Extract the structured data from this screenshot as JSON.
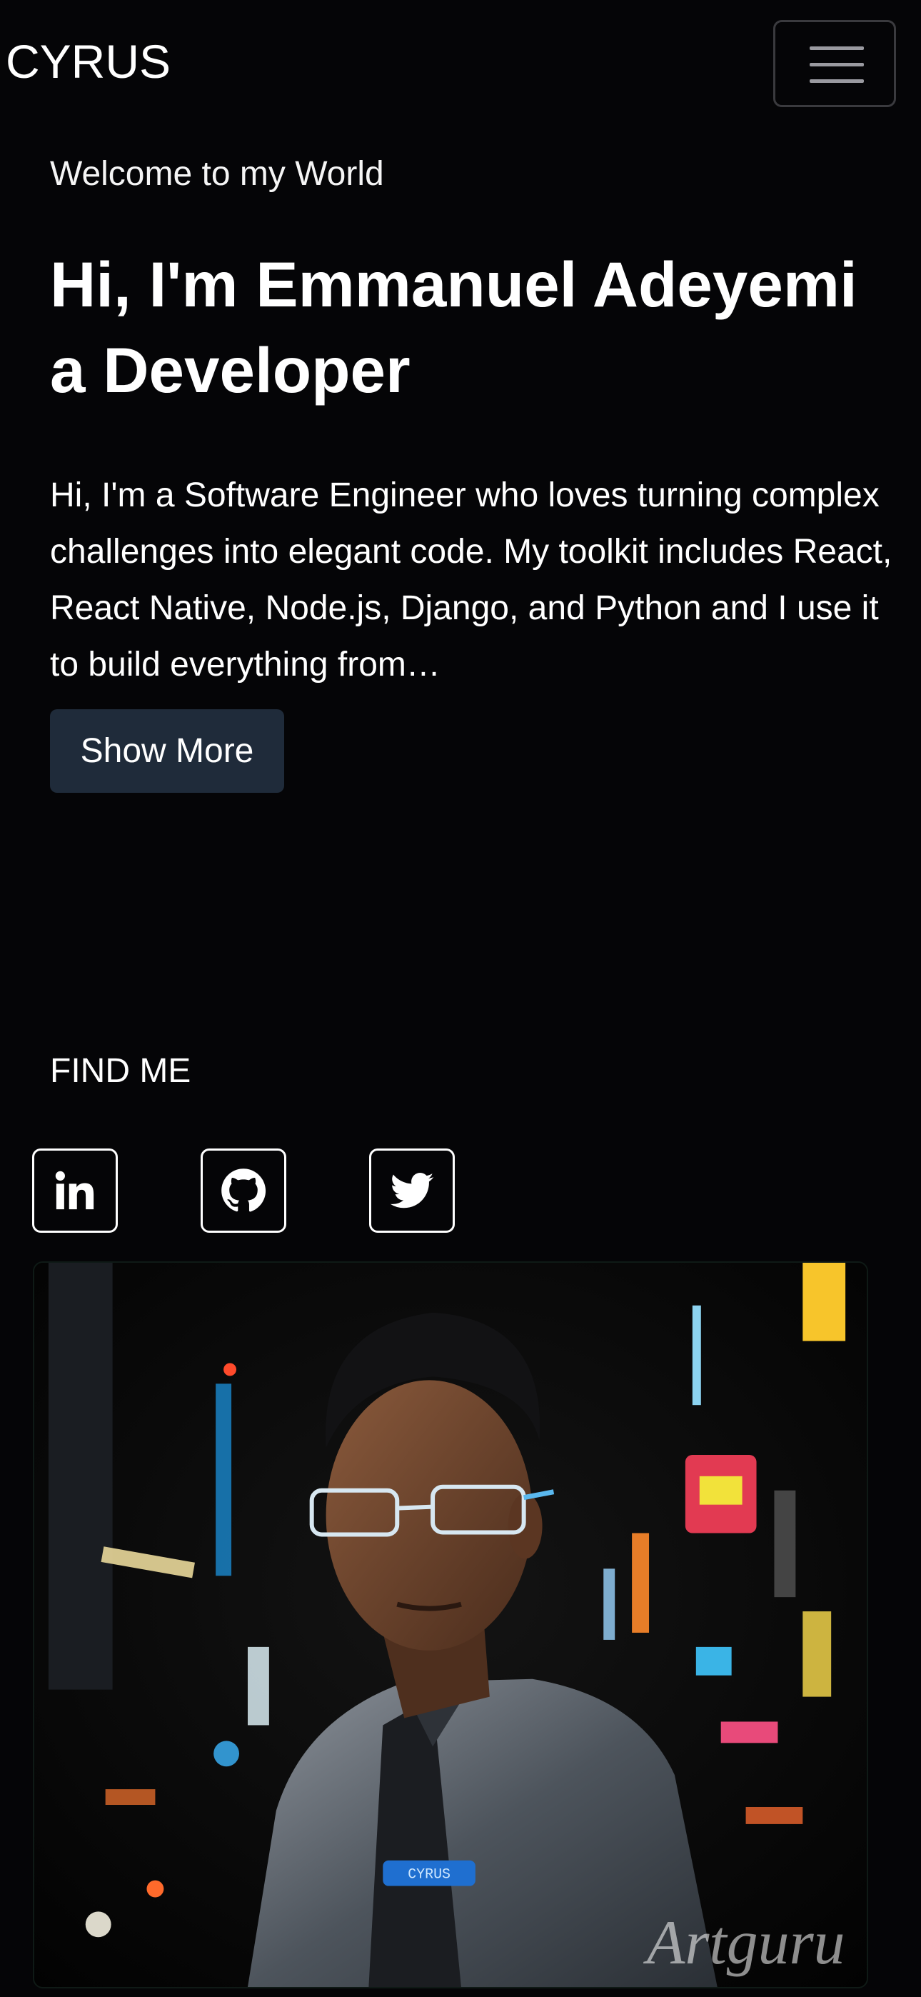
{
  "header": {
    "brand": "CYRUS",
    "menu_icon": "hamburger-icon"
  },
  "hero": {
    "welcome": "Welcome to my World",
    "title": "Hi, I'm Emmanuel Adeyemi a Developer",
    "bio": "Hi, I'm a Software Engineer who loves turning complex challenges into elegant code. My toolkit includes React, React Native, Node.js, Django, and Python and I use it to build everything from…",
    "show_more_label": "Show More"
  },
  "find_me": {
    "heading": "FIND ME",
    "links": [
      {
        "icon": "linkedin-icon"
      },
      {
        "icon": "github-icon"
      },
      {
        "icon": "twitter-icon"
      }
    ]
  },
  "portrait": {
    "watermark": "Artguru",
    "jacket_badge": "CYRUS"
  },
  "colors": {
    "background": "#050507",
    "button": "#1f2b3a",
    "text": "#ffffff"
  }
}
